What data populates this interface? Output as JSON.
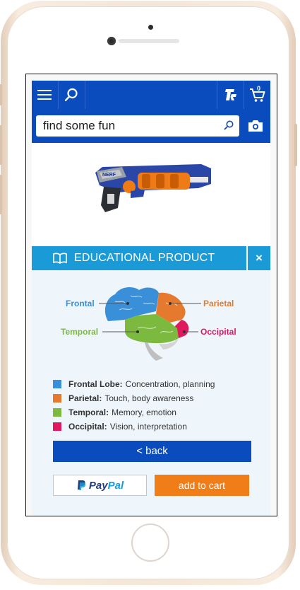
{
  "search": {
    "placeholder": "find some fun"
  },
  "cart": {
    "count": "0"
  },
  "modal": {
    "title": "EDUCATIONAL PRODUCT",
    "close_label": "×",
    "brain_labels": {
      "frontal": "Frontal",
      "parietal": "Parietal",
      "temporal": "Temporal",
      "occipital": "Occipital"
    },
    "legend": [
      {
        "name": "Frontal Lobe:",
        "desc": "Concentration, planning",
        "color": "#3a8fd9"
      },
      {
        "name": "Parietal:",
        "desc": "Touch, body awareness",
        "color": "#e57a2e"
      },
      {
        "name": "Temporal:",
        "desc": "Memory, emotion",
        "color": "#7cba3f"
      },
      {
        "name": "Occipital:",
        "desc": "Vision, interpretation",
        "color": "#e0195e"
      }
    ],
    "back_label": "< back",
    "paypal_label_a": "Pay",
    "paypal_label_b": "Pal",
    "add_to_cart_label": "add to cart"
  },
  "colors": {
    "brand_blue": "#0a4bbd",
    "header_cyan": "#1a9ad6",
    "cart_orange": "#f07d17"
  },
  "icons": [
    "menu-icon",
    "search-icon",
    "toysrus-logo-icon",
    "cart-icon",
    "camera-icon",
    "book-icon",
    "close-icon",
    "paypal-icon"
  ]
}
